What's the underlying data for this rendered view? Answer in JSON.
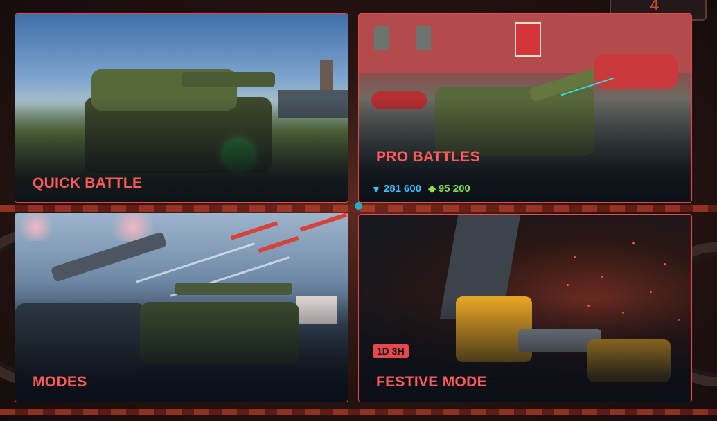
{
  "top_badge": {
    "value": "4"
  },
  "cards": {
    "quick_battle": {
      "title": "QUICK BATTLE"
    },
    "pro_battles": {
      "title": "PRO BATTLES",
      "crystals": "281 600",
      "tankoins": "95 200",
      "crystal_icon": "crystal-icon",
      "tankoin_icon": "tankoin-icon"
    },
    "modes": {
      "title": "MODES"
    },
    "festive_mode": {
      "title": "FESTIVE MODE",
      "timer": "1D 3H"
    }
  },
  "colors": {
    "accent": "#e5484d",
    "title_red": "#ff5a5a",
    "crystal_blue": "#35c6ff",
    "tankoin_green": "#86e048"
  }
}
